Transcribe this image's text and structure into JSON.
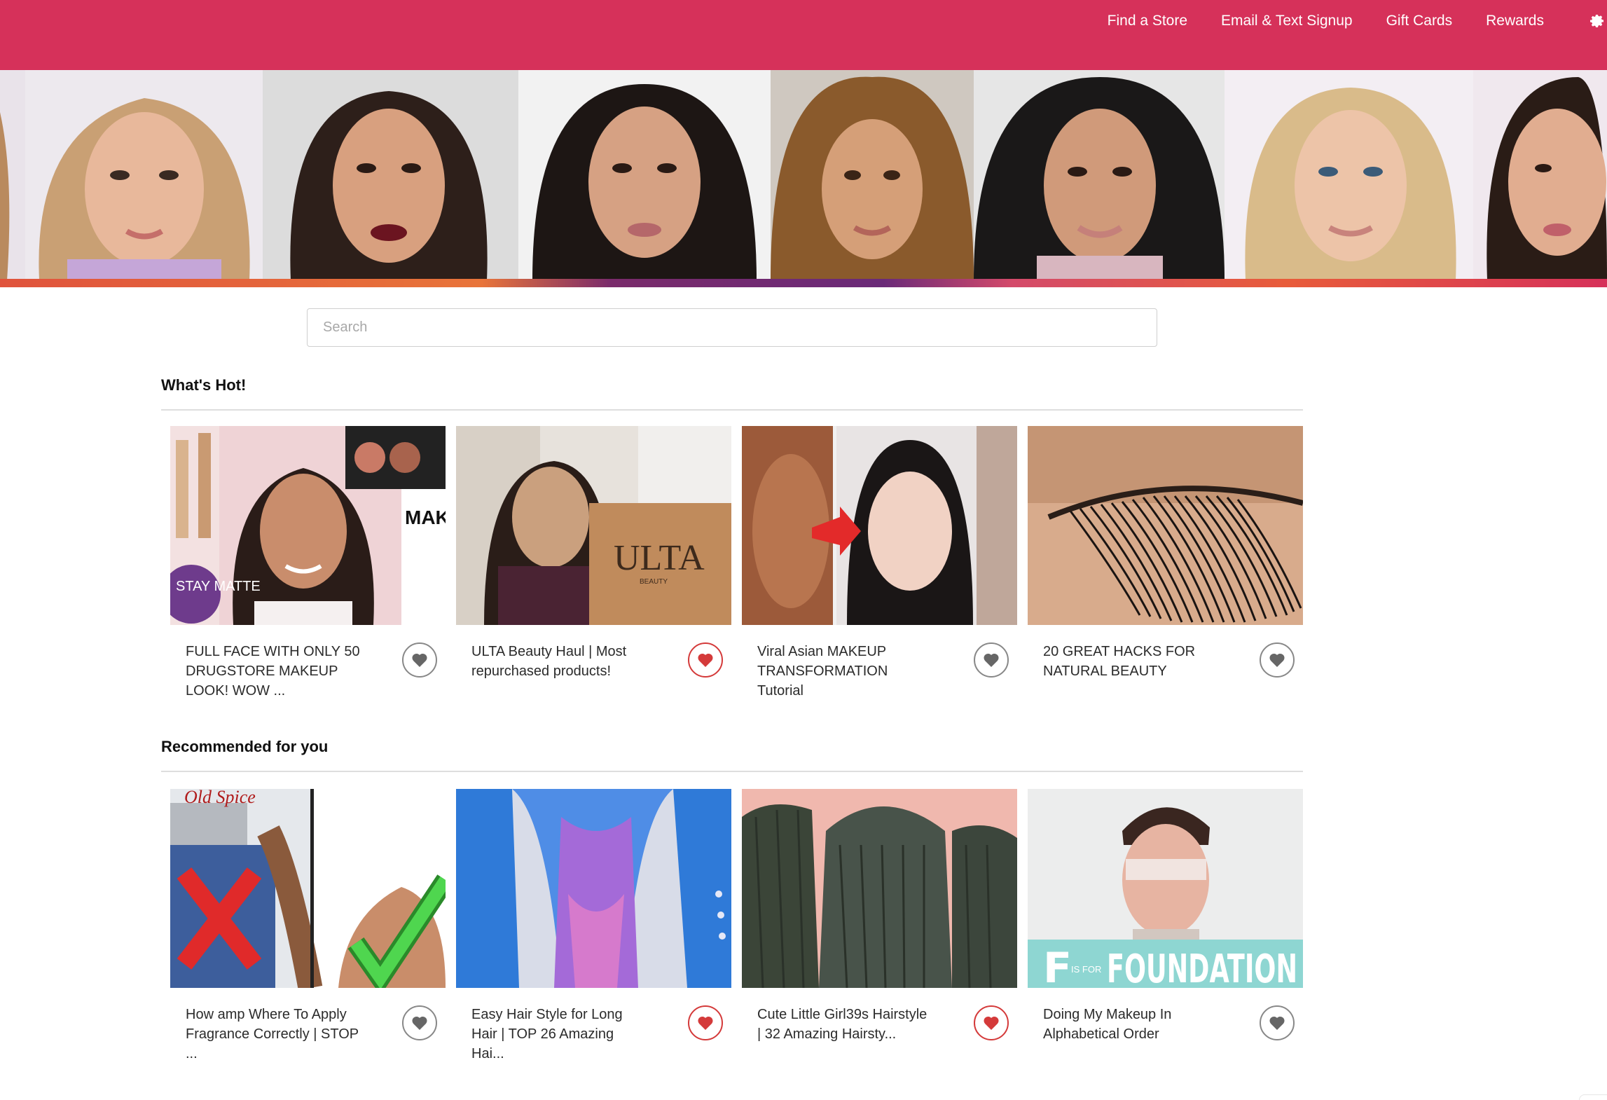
{
  "nav": {
    "links": [
      "Find a Store",
      "Email & Text Signup",
      "Gift Cards",
      "Rewards"
    ],
    "settings_icon": "gear-icon"
  },
  "colors": {
    "brand": "#d6315a",
    "liked_heart": "#d43a3a",
    "unliked_heart": "#666666"
  },
  "search": {
    "placeholder": "Search",
    "value": ""
  },
  "sections": [
    {
      "title": "What's Hot!",
      "items": [
        {
          "caption": "FULL FACE WITH ONLY 50 DRUGSTORE MAKEUP LOOK! WOW ...",
          "liked": false
        },
        {
          "caption": "ULTA Beauty Haul | Most repurchased products!",
          "liked": true
        },
        {
          "caption": "Viral Asian MAKEUP TRANSFORMATION Tutorial",
          "liked": false
        },
        {
          "caption": "20 GREAT HACKS FOR NATURAL BEAUTY",
          "liked": false
        }
      ]
    },
    {
      "title": "Recommended for you",
      "items": [
        {
          "caption": "How amp Where To Apply Fragrance Correctly | STOP ...",
          "liked": false
        },
        {
          "caption": "Easy Hair Style for Long Hair | TOP 26 Amazing Hai...",
          "liked": true
        },
        {
          "caption": "Cute Little Girl39s Hairstyle | 32 Amazing Hairsty...",
          "liked": true
        },
        {
          "caption": "Doing My Makeup In Alphabetical Order",
          "liked": false
        }
      ]
    }
  ],
  "thumb_text": {
    "ulta_box": "ULTA",
    "ulta_beauty": "BEAUTY",
    "old_spice": "Old Spice",
    "foundation_f": "F",
    "foundation_is_for": "IS FOR",
    "foundation_word": "FOUNDATION",
    "stay_matte": "STAY MATTE",
    "makeup_lo": "MAK LO"
  }
}
